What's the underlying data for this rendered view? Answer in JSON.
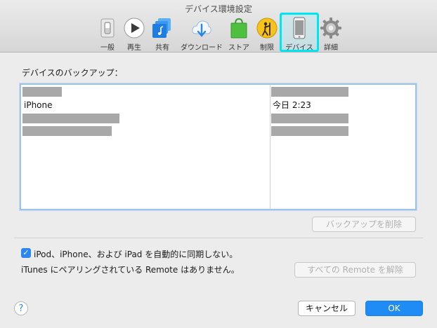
{
  "window": {
    "title": "デバイス環境設定"
  },
  "toolbar": {
    "items": [
      {
        "label": "一般",
        "icon": "general-switch-icon"
      },
      {
        "label": "再生",
        "icon": "playback-icon"
      },
      {
        "label": "共有",
        "icon": "sharing-icon"
      },
      {
        "label": "ダウンロード",
        "icon": "download-icon"
      },
      {
        "label": "ストア",
        "icon": "store-bag-icon"
      },
      {
        "label": "制限",
        "icon": "restrictions-icon"
      },
      {
        "label": "デバイス",
        "icon": "device-phone-icon",
        "selected": true
      },
      {
        "label": "詳細",
        "icon": "gear-icon"
      }
    ]
  },
  "backups": {
    "section_label": "デバイスのバックアップ：",
    "rows": [
      {
        "name": "",
        "date": ""
      },
      {
        "name": "iPhone",
        "date": "今日 2:23"
      },
      {
        "name": "",
        "date": ""
      },
      {
        "name": "",
        "date": ""
      }
    ],
    "delete_button": "バックアップを削除"
  },
  "sync": {
    "checkbox_label": "iPod、iPhone、および iPad を自動的に同期しない。",
    "checked": true
  },
  "remote": {
    "status_text": "iTunes にペアリングされている Remote はありません。",
    "reset_button": "すべての Remote を解除"
  },
  "footer": {
    "help": "?",
    "cancel_button": "キャンセル",
    "ok_button": "OK"
  },
  "colors": {
    "accent": "#1e8cf4",
    "selection_highlight": "#00e6f0"
  }
}
